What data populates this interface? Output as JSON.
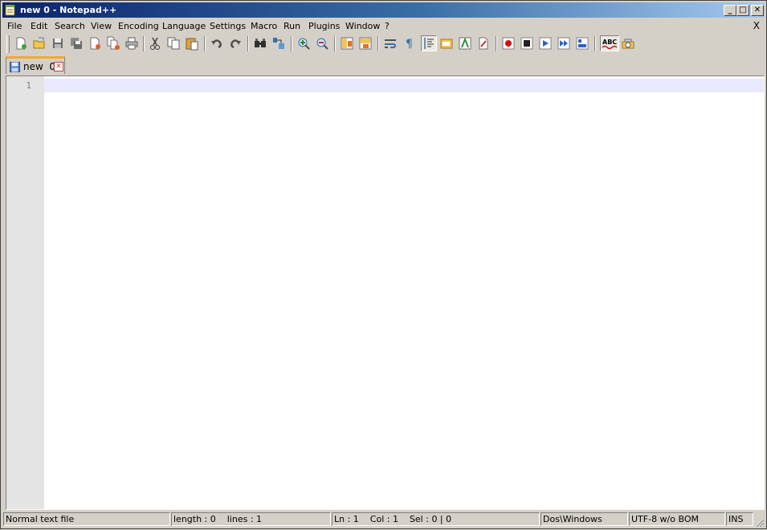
{
  "window": {
    "title": "new  0 - Notepad++",
    "buttons": {
      "minimize": "_",
      "maximize": "□",
      "close": "✕"
    }
  },
  "menu": {
    "items": [
      "File",
      "Edit",
      "Search",
      "View",
      "Encoding",
      "Language",
      "Settings",
      "Macro",
      "Run",
      "Plugins",
      "Window",
      "?"
    ],
    "close_label": "X"
  },
  "toolbar": {
    "buttons": [
      "new-file",
      "open-file",
      "save",
      "save-all",
      "close",
      "close-all",
      "print",
      "cut",
      "copy",
      "paste",
      "undo",
      "redo",
      "find",
      "replace",
      "zoom-in",
      "zoom-out",
      "sync-vertical",
      "sync-horizontal",
      "word-wrap",
      "show-all-characters",
      "indent-guide",
      "user-defined-language",
      "function-list",
      "document-map",
      "record-macro",
      "stop-recording",
      "playback-macro",
      "run-macro-multiple",
      "save-macro",
      "spell-check",
      "launch-in-browser"
    ],
    "spellcheck_label": "ABC"
  },
  "tabs": [
    {
      "label": "new  0",
      "active": true
    }
  ],
  "editor": {
    "line_numbers": [
      "1"
    ],
    "content": ""
  },
  "status": {
    "file_type": "Normal text file",
    "length_lines": "length : 0    lines : 1",
    "position": "Ln : 1    Col : 1    Sel : 0 | 0",
    "eol": "Dos\\Windows",
    "encoding": "UTF-8 w/o BOM",
    "mode": "INS"
  },
  "colors": {
    "title_gradient_start": "#0a246a",
    "title_gradient_end": "#a6caf0",
    "chrome": "#d4d0c8",
    "current_line": "#e8e8ff",
    "gutter": "#e4e4e4",
    "tab_accent": "#f6a82d"
  }
}
